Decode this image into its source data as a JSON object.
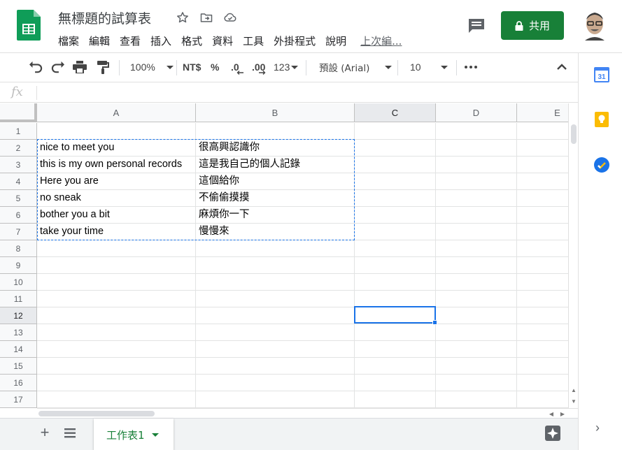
{
  "header": {
    "title": "無標題的試算表",
    "menu": [
      "檔案",
      "編輯",
      "查看",
      "插入",
      "格式",
      "資料",
      "工具",
      "外掛程式",
      "說明"
    ],
    "last_edit": "上次編...",
    "share_label": "共用",
    "icons": [
      "sheets-logo-icon",
      "star-icon",
      "move-to-folder-icon",
      "cloud-status-icon",
      "comment-icon",
      "lock-icon"
    ]
  },
  "toolbar": {
    "zoom": "100%",
    "currency": "NT$",
    "percent": "%",
    "dec_decrease": ".0",
    "dec_increase": ".00",
    "more_formats": "123",
    "font": "預設 (Arial)",
    "font_size": "10",
    "icons": [
      "undo-icon",
      "redo-icon",
      "print-icon",
      "paint-format-icon",
      "more-icon",
      "collapse-icon"
    ]
  },
  "formula_bar": {
    "label": "fx",
    "value": ""
  },
  "grid": {
    "columns": [
      "A",
      "B",
      "C",
      "D",
      "E"
    ],
    "selected_column": "C",
    "rows": [
      "1",
      "2",
      "3",
      "4",
      "5",
      "6",
      "7",
      "8",
      "9",
      "10",
      "11",
      "12",
      "13",
      "14",
      "15",
      "16",
      "17"
    ],
    "selected_row": "12",
    "cells": {
      "A2": "nice to meet you",
      "B2": "很高興認識你",
      "A3": "this is my own personal records",
      "B3": "這是我自己的個人記錄",
      "A4": "Here you are",
      "B4": "這個給你",
      "A5": "no sneak",
      "B5": "不偷偷摸摸",
      "A6": "bother you a bit",
      "B6": "麻煩你一下",
      "A7": "take your time",
      "B7": "慢慢來"
    },
    "copied_range": "A2:B7",
    "active_cell": "C12"
  },
  "bottom": {
    "sheet_tabs": [
      "工作表1"
    ],
    "active_sheet": "工作表1"
  },
  "side_panel": {
    "calendar_day": "31",
    "icons": [
      "calendar-icon",
      "keep-icon",
      "tasks-icon",
      "expand-panel-icon"
    ]
  },
  "colors": {
    "brand_green": "#188038",
    "selection_blue": "#1a73e8",
    "keep_yellow": "#fbbc04",
    "calendar_blue": "#4285f4"
  }
}
